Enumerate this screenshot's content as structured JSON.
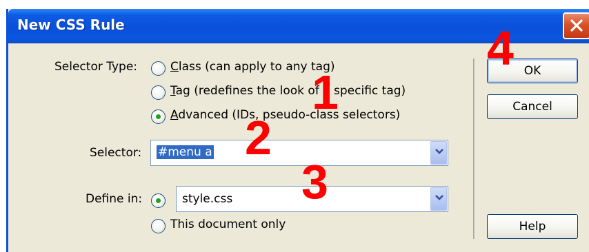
{
  "window": {
    "title": "New CSS Rule"
  },
  "selector_type": {
    "label": "Selector Type:",
    "options": [
      {
        "key": "C",
        "rest": "lass (can apply to any tag)",
        "checked": false
      },
      {
        "key": "T",
        "rest": "ag (redefines the look of a specific tag)",
        "checked": false
      },
      {
        "key": "A",
        "rest": "dvanced (IDs, pseudo-class selectors)",
        "checked": true
      }
    ]
  },
  "selector": {
    "label": "Selector:",
    "value": "#menu a"
  },
  "define_in": {
    "label": "Define in:",
    "file_value": "style.css",
    "file_checked": true,
    "doc_only_label": "This document only",
    "doc_only_checked": false
  },
  "buttons": {
    "ok": "OK",
    "cancel": "Cancel",
    "help": "Help"
  },
  "annotations": [
    "1",
    "2",
    "3",
    "4"
  ],
  "colors": {
    "titlebar": "#0a4fd8",
    "annotation": "#ff0000",
    "dialog_bg": "#ece9d8",
    "radio_dot": "#21a121"
  },
  "icons": {
    "close": "close-icon",
    "dropdown": "chevron-down-icon"
  }
}
